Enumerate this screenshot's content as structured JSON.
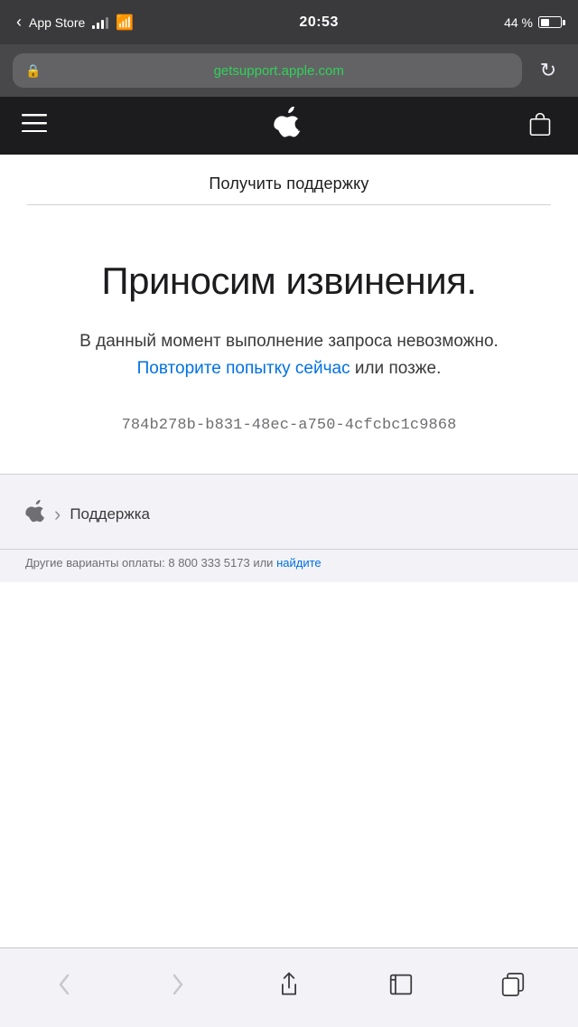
{
  "statusBar": {
    "appName": "App Store",
    "time": "20:53",
    "battery": "44 %"
  },
  "urlBar": {
    "url": "getsupport.apple.com",
    "secure": true
  },
  "nav": {
    "logoSymbol": "",
    "menuIcon": "≡",
    "bagIcon": "bag"
  },
  "pageTitle": "Получить поддержку",
  "errorPage": {
    "heading": "Приносим извинения.",
    "bodyPrefix": "В данный момент выполнение запроса невозможно. ",
    "retryLinkText": "Повторите попытку сейчас",
    "bodySuffix": " или позже.",
    "errorCode": "784b278b-b831-48ec-a750-4cfcbc1c9868"
  },
  "breadcrumb": {
    "appleSymbol": "",
    "chevron": "›",
    "label": "Поддержка"
  },
  "footer": {
    "text": "Другие варианты оплаты: 8 800 333 5173 или ",
    "linkText": "найдите"
  },
  "bottomBar": {
    "back": "‹",
    "forward": "›",
    "share": "share",
    "bookmarks": "bookmarks",
    "tabs": "tabs"
  }
}
